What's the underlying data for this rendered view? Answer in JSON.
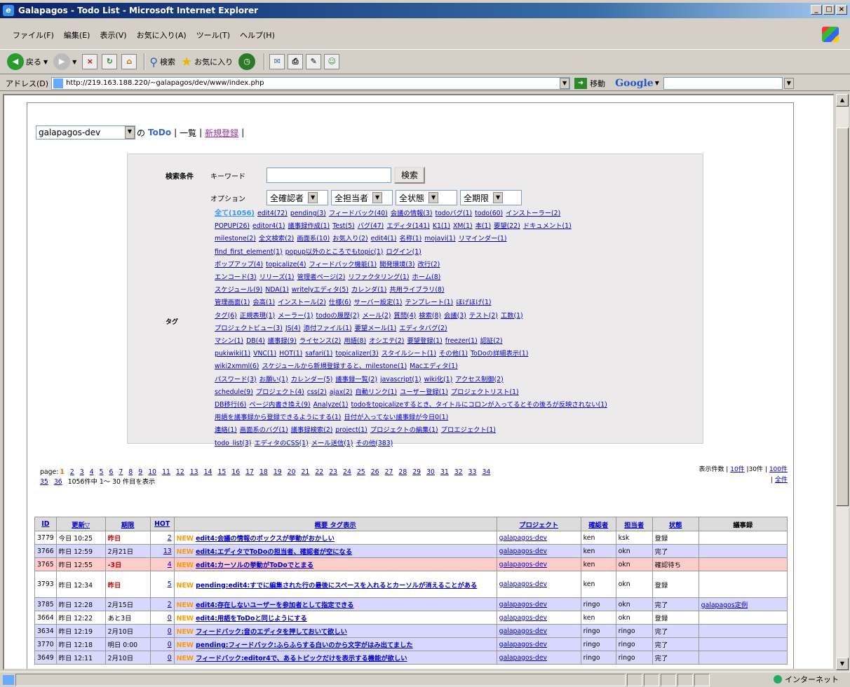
{
  "window": {
    "title": "Galapagos - Todo List - Microsoft Internet Explorer",
    "buttons": [
      "_",
      "□",
      "×"
    ]
  },
  "menu": [
    "ファイル(F)",
    "編集(E)",
    "表示(V)",
    "お気に入り(A)",
    "ツール(T)",
    "ヘルプ(H)"
  ],
  "toolbar": {
    "back": "戻る",
    "search": "検索",
    "favorites": "お気に入り"
  },
  "address": {
    "label": "アドレス(D)",
    "url": "http://219.163.188.220/~galapagos/dev/www/index.php",
    "go": "移動",
    "google": "Google"
  },
  "status": {
    "zone": "インターネット"
  },
  "header": {
    "project": "galapagos-dev",
    "no": "の",
    "todo": "ToDo",
    "sep1": "|",
    "list": "一覧",
    "sep2": "|",
    "new": "新規登録",
    "sep3": "|"
  },
  "search": {
    "label": "検索条件",
    "keyword_label": "キーワード",
    "keyword_value": "",
    "button": "検索",
    "option_label": "オプション",
    "options": [
      "全確認者",
      "全担当者",
      "全状態",
      "全期限"
    ],
    "tag_label": "タグ",
    "tag_lines": [
      [
        "全て(1056)",
        "edit4(72)",
        "pending(3)",
        "フィードバック(40)",
        "会議の情報(3)",
        "todoバグ(1)",
        "todo(60)",
        "インストーラー(2)"
      ],
      [
        "POPUP(26)",
        "editor4(1)",
        "議事録作成(1)",
        "Test(5)",
        "バグ(47)",
        "エディタ(141)",
        "K1(1)",
        "XM(1)",
        "本(1)",
        "要望(22)",
        "ドキュメント(1)"
      ],
      [
        "milestone(2)",
        "全文検索(2)",
        "画面系(10)",
        "お気入り(2)",
        "edit4(1)",
        "名称(1)",
        "mojavi(1)",
        "リマインダー(1)"
      ],
      [
        "find_first_element(1)",
        "popup以外のところでもtopic(1)",
        "ログイン(1)"
      ],
      [
        "ポップアップ(4)",
        "topicalize(4)",
        "フィードバック機能(1)",
        "開発環境(3)",
        "改行(2)"
      ],
      [
        "エンコード(3)",
        "リリーズ(1)",
        "管理者ページ(2)",
        "リファクタリング(1)",
        "ホーム(8)"
      ],
      [
        "スケジュール(9)",
        "NDA(1)",
        "writelyエディタ(5)",
        "カレンダ(1)",
        "共用ライブラリ(8)"
      ],
      [
        "管理画面(1)",
        "会高(1)",
        "インストール(2)",
        "仕様(6)",
        "サーバー設定(1)",
        "テンプレート(1)",
        "ほげほげ(1)"
      ],
      [
        "タグ(6)",
        "正規表現(1)",
        "メーラー(1)",
        "todoの履歴(2)",
        "メール(2)",
        "質問(4)",
        "検索(8)",
        "会議(3)",
        "テスト(2)",
        "工数(1)"
      ],
      [
        "プロジェクトビュー(3)",
        "JS(4)",
        "添付ファイル(1)",
        "要望メール(1)",
        "エディタバグ(2)"
      ],
      [
        "マシン(1)",
        "DB(4)",
        "議事録(9)",
        "ライセンス(2)",
        "用語(8)",
        "オシエテ(2)",
        "要望登録(1)",
        "freezer(1)",
        "認証(2)"
      ],
      [
        "pukiwiki(1)",
        "VNC(1)",
        "HOT(1)",
        "safari(1)",
        "topicalizer(3)",
        "スタイルシート(1)",
        "その他(1)",
        "ToDoの詳細表示(1)"
      ],
      [
        "wiki2xmml(6)",
        "スケジュールから新規登録すると、milestone(1)",
        "Macエディタ(1)"
      ],
      [
        "パスワード(3)",
        "お願い(1)",
        "カレンダー(5)",
        "議事録一覧(2)",
        "javascript(1)",
        "wiki化(1)",
        "アクセス制御(2)"
      ],
      [
        "schedule(9)",
        "プロジェクト(4)",
        "css(2)",
        "ajax(2)",
        "自動リンク(1)",
        "ユーザー登録(1)",
        "プロジェクトリスト(1)"
      ],
      [
        "DB移行(6)",
        "ページ内書き換え(9)",
        "Analyze(1)",
        "todoをtopicalizeするとき、タイトルにコロンが入ってるとその後ろが反映されない(1)"
      ],
      [
        "用語を議事録から登録できるようにする(1)",
        "日付が入ってない議事録が今日0(1)"
      ],
      [
        "連絡(1)",
        "画面系のバグ(1)",
        "議事録検索(2)",
        "project(1)",
        "プロジェクトの編集(1)",
        "プロエジェクト(1)"
      ],
      [
        "todo_list(3)",
        "エディタのCSS(1)",
        "メール送信(1)",
        "その他(383)"
      ]
    ]
  },
  "pager": {
    "label": "page:",
    "current": "1",
    "pages": [
      "2",
      "3",
      "4",
      "5",
      "6",
      "7",
      "8",
      "9",
      "10",
      "11",
      "12",
      "13",
      "14",
      "15",
      "16",
      "17",
      "18",
      "19",
      "20",
      "21",
      "22",
      "23",
      "24",
      "25",
      "26",
      "27",
      "28",
      "29",
      "30",
      "31",
      "32",
      "33",
      "34",
      "35",
      "36"
    ],
    "summary": "1056件中 1～ 30 件目を表示",
    "display_label": "表示件数 |",
    "display_10": "10件",
    "display_30": "|30件 |",
    "display_100": "100件",
    "display_all_prefix": "|",
    "display_all": "全件"
  },
  "table": {
    "headers": [
      "ID",
      "更新▽",
      "期限",
      "HOT",
      "概要 タグ表示",
      "プロジェクト",
      "確認者",
      "担当者",
      "状態",
      "議事録"
    ],
    "new_label": "NEW",
    "rows": [
      {
        "style": "white",
        "id": "3779",
        "updated": "今日 10:25",
        "due": "昨日",
        "due_red": true,
        "hot": "2",
        "summary": "edit4:会議の情報のボックスが挙動がおかしい",
        "project": "galapagos-dev",
        "confirmer": "ken",
        "assignee": "ksk",
        "state": "登録",
        "minutes": ""
      },
      {
        "style": "blue",
        "id": "3766",
        "updated": "昨日 12:59",
        "due": "2月21日",
        "due_red": false,
        "hot": "13",
        "summary": "edit4:エディタでToDoの担当者、確認者が空になる",
        "project": "galapagos-dev",
        "confirmer": "ken",
        "assignee": "okn",
        "state": "完了",
        "minutes": ""
      },
      {
        "style": "pink",
        "id": "3765",
        "updated": "昨日 12:55",
        "due": "-3日",
        "due_red": true,
        "hot": "4",
        "summary": "edit4:カーソルの挙動がToDoでとまる",
        "project": "galapagos-dev",
        "confirmer": "ken",
        "assignee": "okn",
        "state": "確認待ち",
        "minutes": ""
      },
      {
        "style": "white",
        "id": "3793",
        "updated": "昨日 12:34",
        "due": "昨日",
        "due_red": true,
        "hot": "5",
        "summary": "pending:edit4:すでに編集された行の最後にスペースを入れるとカーソルが消えることがある",
        "project": "galapagos-dev",
        "confirmer": "ken",
        "assignee": "okn",
        "state": "登録",
        "minutes": "",
        "tall": true
      },
      {
        "style": "blue",
        "id": "3785",
        "updated": "昨日 12:28",
        "due": "2月15日",
        "due_red": false,
        "hot": "2",
        "summary": "edit4:存在しないユーザーを参加者として指定できる",
        "project": "galapagos-dev",
        "confirmer": "ringo",
        "assignee": "okn",
        "state": "完了",
        "minutes": "galapagos定例"
      },
      {
        "style": "white",
        "id": "3664",
        "updated": "昨日 12:22",
        "due": "あと3日",
        "due_red": false,
        "hot": "0",
        "summary": "edit4:用語をToDoと同じようにする",
        "project": "galapagos-dev",
        "confirmer": "ken",
        "assignee": "okn",
        "state": "登録",
        "minutes": ""
      },
      {
        "style": "blue",
        "id": "3634",
        "updated": "昨日 12:19",
        "due": "2月10日",
        "due_red": false,
        "hot": "0",
        "summary": "フィードバック:音のエディタを押しておいて欲しい",
        "project": "galapagos-dev",
        "confirmer": "ringo",
        "assignee": "ringo",
        "state": "完了",
        "minutes": ""
      },
      {
        "style": "blue",
        "id": "3770",
        "updated": "昨日 12:18",
        "due": "明日 0:00",
        "due_red": false,
        "hot": "0",
        "summary": "pending:フィードバック:ふらふらする白いのから文字がはみ出てました",
        "project": "galapagos-dev",
        "confirmer": "ringo",
        "assignee": "ringo",
        "state": "完了",
        "minutes": ""
      },
      {
        "style": "blue",
        "id": "3649",
        "updated": "昨日 12:11",
        "due": "2月10日",
        "due_red": false,
        "hot": "0",
        "summary": "フィードバック:editor4で、あるトピックだけを表示する機能が欲しい",
        "project": "galapagos-dev",
        "confirmer": "ringo",
        "assignee": "ringo",
        "state": "完了",
        "minutes": ""
      }
    ]
  }
}
